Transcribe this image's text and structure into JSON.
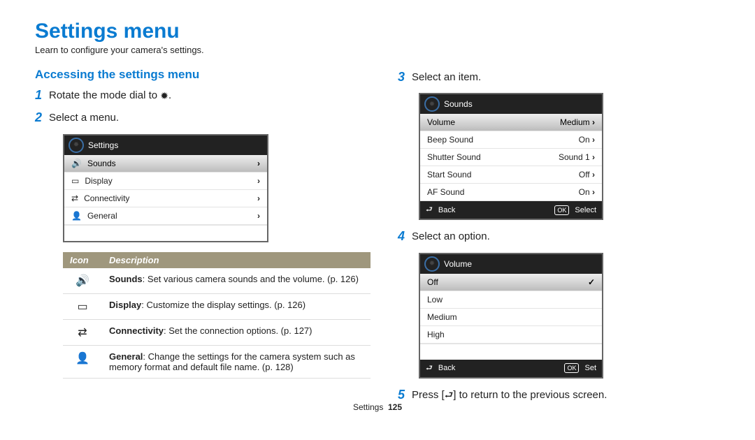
{
  "title": "Settings menu",
  "subtitle": "Learn to configure your camera's settings.",
  "left": {
    "heading": "Accessing the settings menu",
    "step1_pre": "Rotate the mode dial to ",
    "step1_post": ".",
    "step2": "Select a menu.",
    "cam1": {
      "title": "Settings",
      "rows": [
        {
          "label": "Sounds"
        },
        {
          "label": "Display"
        },
        {
          "label": "Connectivity"
        },
        {
          "label": "General"
        }
      ]
    },
    "table": {
      "head_icon": "Icon",
      "head_desc": "Description",
      "rows": [
        {
          "bold": "Sounds",
          "rest": ": Set various camera sounds and the volume. (p. 126)"
        },
        {
          "bold": "Display",
          "rest": ": Customize the display settings. (p. 126)"
        },
        {
          "bold": "Connectivity",
          "rest": ": Set the connection options. (p. 127)"
        },
        {
          "bold": "General",
          "rest": ": Change the settings for the camera system such as memory format and default file name. (p. 128)"
        }
      ]
    }
  },
  "right": {
    "step3": "Select an item.",
    "cam2": {
      "title": "Sounds",
      "rows": [
        {
          "label": "Volume",
          "value": "Medium",
          "hl": true
        },
        {
          "label": "Beep Sound",
          "value": "On"
        },
        {
          "label": "Shutter Sound",
          "value": "Sound 1"
        },
        {
          "label": "Start Sound",
          "value": "Off"
        },
        {
          "label": "AF Sound",
          "value": "On"
        }
      ],
      "back": "Back",
      "select": "Select"
    },
    "step4": "Select an option.",
    "cam3": {
      "title": "Volume",
      "rows": [
        {
          "label": "Off",
          "checked": true
        },
        {
          "label": "Low"
        },
        {
          "label": "Medium"
        },
        {
          "label": "High"
        }
      ],
      "back": "Back",
      "set": "Set"
    },
    "step5_pre": "Press [",
    "step5_post": "] to return to the previous screen."
  },
  "footer": {
    "label": "Settings",
    "page": "125"
  }
}
